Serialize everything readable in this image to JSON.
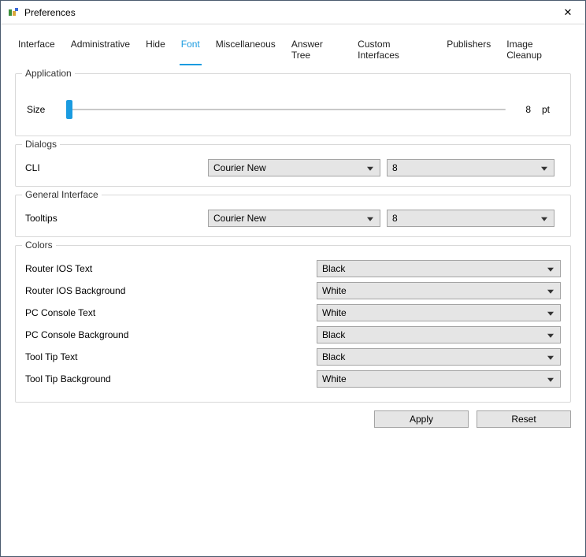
{
  "window": {
    "title": "Preferences",
    "close_glyph": "✕"
  },
  "tabs": [
    {
      "label": "Interface"
    },
    {
      "label": "Administrative"
    },
    {
      "label": "Hide"
    },
    {
      "label": "Font",
      "active": true
    },
    {
      "label": "Miscellaneous"
    },
    {
      "label": "Answer Tree"
    },
    {
      "label": "Custom Interfaces"
    },
    {
      "label": "Publishers"
    },
    {
      "label": "Image Cleanup"
    }
  ],
  "application": {
    "legend": "Application",
    "size_label": "Size",
    "size_value": "8",
    "size_unit": "pt"
  },
  "dialogs": {
    "legend": "Dialogs",
    "cli_label": "CLI",
    "cli_font": "Courier New",
    "cli_size": "8"
  },
  "general_interface": {
    "legend": "General Interface",
    "tooltips_label": "Tooltips",
    "tooltips_font": "Courier New",
    "tooltips_size": "8"
  },
  "colors": {
    "legend": "Colors",
    "rows": [
      {
        "label": "Router IOS Text",
        "value": "Black"
      },
      {
        "label": "Router IOS Background",
        "value": "White"
      },
      {
        "label": "PC Console Text",
        "value": "White"
      },
      {
        "label": "PC Console Background",
        "value": "Black"
      },
      {
        "label": "Tool Tip Text",
        "value": "Black"
      },
      {
        "label": "Tool Tip Background",
        "value": "White"
      }
    ]
  },
  "buttons": {
    "apply": "Apply",
    "reset": "Reset"
  }
}
